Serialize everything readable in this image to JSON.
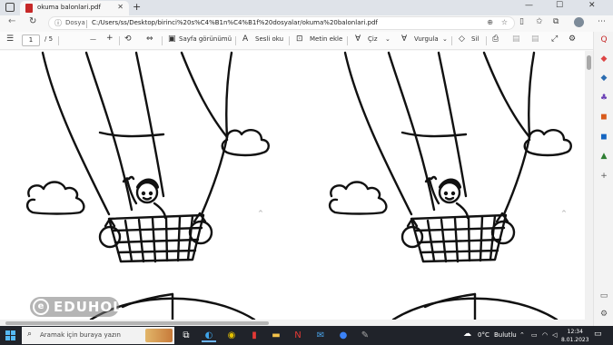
{
  "browser": {
    "tab_title": "okuma balonlari.pdf",
    "tab_close": "✕",
    "new_tab": "+",
    "window_controls": {
      "minimize": "—",
      "maximize": "☐",
      "close": "✕"
    }
  },
  "address_bar": {
    "scheme_label": "Dosya",
    "url": "C:/Users/ss/Desktop/birinci%20s%C4%B1n%C4%B1f%20dosyalar/okuma%20balonlari.pdf"
  },
  "pdf_toolbar": {
    "current_page": "1",
    "page_total": "/ 5",
    "zoom_out": "—",
    "zoom_in": "+",
    "page_view_label": "Sayfa görünümü",
    "read_aloud_label": "Sesli oku",
    "add_text_label": "Metin ekle",
    "draw_label": "Çiz",
    "highlight_label": "Vurgula",
    "erase_label": "Sil"
  },
  "watermark": {
    "logo_text": "EDUHOL",
    "logo_letter": "e"
  },
  "taskbar": {
    "search_placeholder": "Aramak için buraya yazın",
    "weather_temp": "0°C",
    "weather_desc": "Bulutlu",
    "time": "12:34",
    "date": "8.01.2023"
  },
  "colors": {
    "taskbar_bg": "#20232a",
    "accent": "#1f5fa8",
    "pdf_icon": "#c62828"
  }
}
